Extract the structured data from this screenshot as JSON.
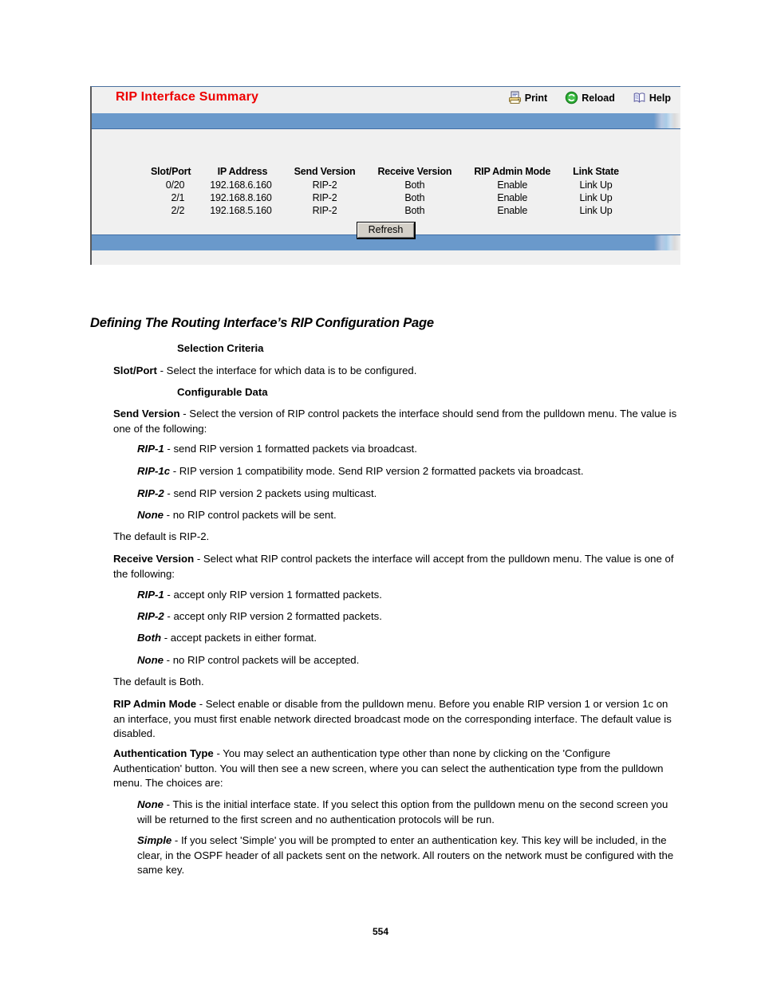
{
  "screenshot_panel": {
    "title": "RIP Interface Summary",
    "title_color": "#ee0000",
    "banner_color": "#6a99cb",
    "toolbar": [
      {
        "icon": "printer-icon",
        "label": "Print"
      },
      {
        "icon": "reload-icon",
        "label": "Reload"
      },
      {
        "icon": "help-book-icon",
        "label": "Help"
      }
    ],
    "table": {
      "columns": [
        "Slot/Port",
        "IP Address",
        "Send Version",
        "Receive Version",
        "RIP Admin Mode",
        "Link State"
      ],
      "rows": [
        [
          "0/20",
          "192.168.6.160",
          "RIP-2",
          "Both",
          "Enable",
          "Link Up"
        ],
        [
          "2/1",
          "192.168.8.160",
          "RIP-2",
          "Both",
          "Enable",
          "Link Up"
        ],
        [
          "2/2",
          "192.168.5.160",
          "RIP-2",
          "Both",
          "Enable",
          "Link Up"
        ]
      ]
    },
    "refresh_label": "Refresh"
  },
  "document": {
    "section_heading": "Defining The Routing Interface’s RIP Configuration Page",
    "selection_criteria_heading": "Selection Criteria",
    "slot_port_term": "Slot/Port",
    "slot_port_text": " - Select the interface for which data is to be configured.",
    "configurable_data_heading": "Configurable Data",
    "send_version_term": "Send Version",
    "send_version_text": " - Select the version of RIP control packets the interface should send from the pulldown menu. The value is one of the following:",
    "send_rip1_term": "RIP-1",
    "send_rip1_text": " - send RIP version 1 formatted packets via broadcast.",
    "send_rip1c_term": "RIP-1c",
    "send_rip1c_text": " - RIP version 1 compatibility mode. Send RIP version 2 formatted packets via broadcast.",
    "send_rip2_term": "RIP-2",
    "send_rip2_text": " - send RIP version 2 packets using multicast.",
    "send_none_term": "None",
    "send_none_text": " - no RIP control packets will be sent.",
    "send_default": "The default is RIP-2.",
    "receive_version_term": "Receive Version",
    "receive_version_text": " - Select what RIP control packets the interface will accept from the pulldown menu. The value is one of the following:",
    "recv_rip1_term": "RIP-1",
    "recv_rip1_text": " - accept only RIP version 1 formatted packets.",
    "recv_rip2_term": "RIP-2",
    "recv_rip2_text": " - accept only RIP version 2 formatted packets.",
    "recv_both_term": "Both",
    "recv_both_text": " - accept packets in either format.",
    "recv_none_term": "None",
    "recv_none_text": " - no RIP control packets will be accepted.",
    "recv_default": "The default is Both.",
    "admin_mode_term": "RIP Admin Mode",
    "admin_mode_text": " - Select enable or disable from the pulldown menu. Before you enable RIP version 1 or version 1c on an interface, you must first enable network directed broadcast mode on the corresponding interface. The default value is disabled.",
    "auth_type_term": "Authentication Type",
    "auth_type_text": " - You may select an authentication type other than none by clicking on the 'Configure Authentication' button. You will then see a new screen, where you can select the authentication type from the pulldown menu. The choices are:",
    "auth_none_term": "None",
    "auth_none_text": " - This is the initial interface state. If you select this option from the pulldown menu on the second screen you will be returned to the first screen and no authentication protocols will be run.",
    "auth_simple_term": "Simple",
    "auth_simple_text": " - If you select 'Simple' you will be prompted to enter an authentication key. This key will be included, in the clear, in the OSPF header of all packets sent on the network. All routers on the network must be configured with the same key."
  },
  "page_number": "554"
}
